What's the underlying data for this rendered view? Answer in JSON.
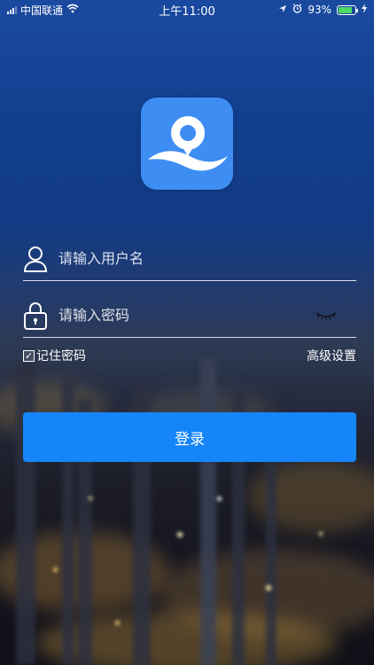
{
  "status_bar": {
    "carrier": "中国联通",
    "time": "上午11:00",
    "battery": "93%"
  },
  "logo": {
    "icon": "location-pin-icon",
    "color": "#3d8df3"
  },
  "form": {
    "username_placeholder": "请输入用户名",
    "password_placeholder": "请输入密码",
    "remember_label": "记住密码",
    "remember_checked": true,
    "advanced_label": "高级设置",
    "login_label": "登录"
  },
  "colors": {
    "accent": "#1585f8",
    "battery": "#4cd964"
  }
}
